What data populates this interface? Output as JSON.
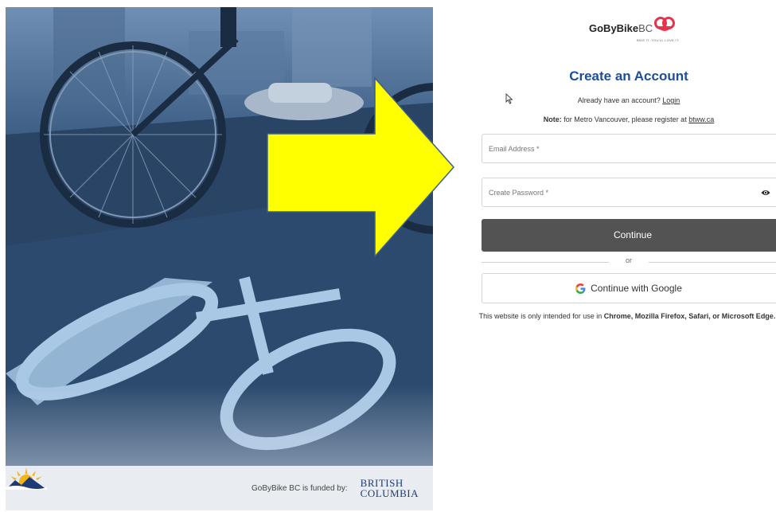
{
  "hero": {
    "funded_text": "GoByBike BC is funded by:",
    "bc_logo_line1": "BRITISH",
    "bc_logo_line2": "COLUMBIA"
  },
  "brand": {
    "name_main": "GoByBike",
    "name_suffix": "BC",
    "tagline": "BIKE IT. YOU'LL LOVE IT."
  },
  "form": {
    "title": "Create an Account",
    "have_account_text": "Already have an account?",
    "login_link": "Login",
    "note_label": "Note:",
    "note_text": "for Metro Vancouver, please register at",
    "note_link": "btww.ca",
    "email_placeholder": "Email Address *",
    "password_placeholder": "Create Password *",
    "continue_label": "Continue",
    "divider_text": "or",
    "google_label": "Continue with Google",
    "disclaimer_prefix": "This website is only intended for use in",
    "disclaimer_browsers": "Chrome, Mozilla Firefox, Safari, or Microsoft Edge."
  },
  "colors": {
    "title": "#1d4e9a",
    "continue_bg": "#535353",
    "arrow_fill": "#ffff00",
    "hero_tint": "#1d3a5e"
  },
  "icons": {
    "password_toggle": "eye-icon",
    "google": "google-g-icon",
    "brand": "bike-wheels-logo-icon",
    "cursor": "mouse-pointer-icon",
    "arrow": "yellow-arrow-annotation"
  }
}
